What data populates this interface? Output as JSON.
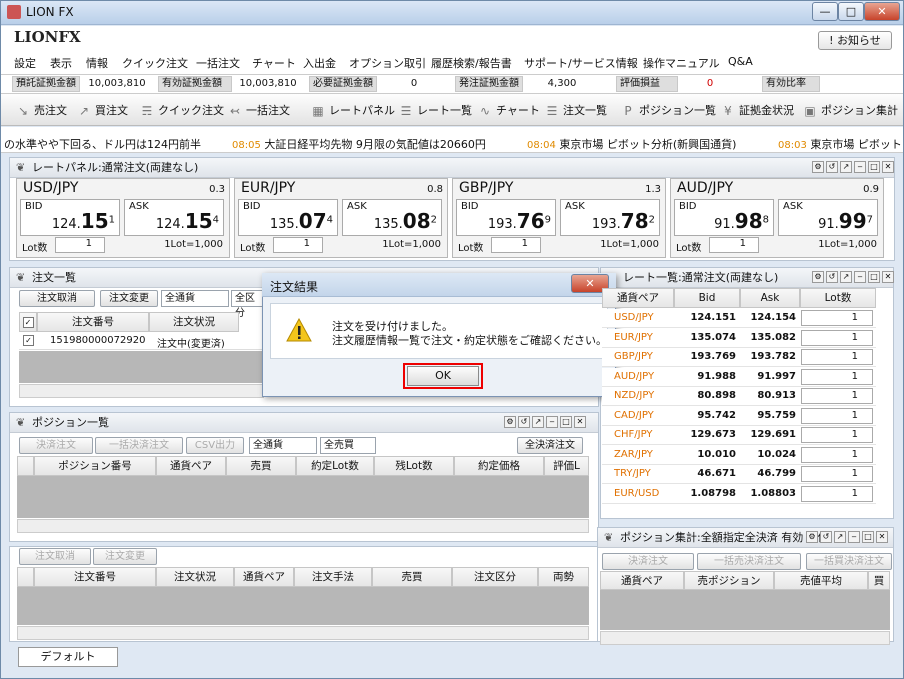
{
  "window": {
    "title": "LION FX",
    "minimize": "—",
    "maximize": "□",
    "close": "✕"
  },
  "brand": {
    "logo": "LIONFX",
    "notice_button": "! お知らせ"
  },
  "menu": [
    "設定",
    "表示",
    "情報",
    "クイック注文",
    "一括注文",
    "チャート",
    "入出金",
    "オプション取引",
    "履歴検索/報告書",
    "サポート/サービス情報",
    "操作マニュアル",
    "Q&A"
  ],
  "summary": [
    {
      "label": "預託証拠金額",
      "value": "10,003,810"
    },
    {
      "label": "有効証拠金額",
      "value": "10,003,810"
    },
    {
      "label": "必要証拠金額",
      "value": "0"
    },
    {
      "label": "発注証拠金額",
      "value": "4,300"
    },
    {
      "label": "評価損益",
      "value": "0",
      "value_color": "#d00000"
    },
    {
      "label": "有効比率",
      "value": ""
    }
  ],
  "toolbar": [
    "売注文",
    "買注文",
    "クイック注文",
    "一括注文",
    "レートパネル",
    "レート一覧",
    "チャート",
    "注文一覧",
    "ポジション一覧",
    "証拠金状況",
    "ポジション集計"
  ],
  "ticker": [
    {
      "time": "",
      "text": "の水準やや下回る、ドル円は124円前半"
    },
    {
      "time": "08:05",
      "text": "大証日経平均先物 9月限の気配値は20660円"
    },
    {
      "time": "08:04",
      "text": "東京市場 ピボット分析(新興国通貨)"
    },
    {
      "time": "08:03",
      "text": "東京市場 ピボット"
    }
  ],
  "rate_panel": {
    "title": "レートパネル:通常注文(両建なし)",
    "cards": [
      {
        "pair": "USD/JPY",
        "spread": "0.3",
        "bid": {
          "pre": "124.",
          "big": "15",
          "sup": "1"
        },
        "ask": {
          "pre": "124.",
          "big": "15",
          "sup": "4"
        },
        "lot": "1",
        "lot_unit": "1Lot=1,000"
      },
      {
        "pair": "EUR/JPY",
        "spread": "0.8",
        "bid": {
          "pre": "135.",
          "big": "07",
          "sup": "4"
        },
        "ask": {
          "pre": "135.",
          "big": "08",
          "sup": "2"
        },
        "lot": "1",
        "lot_unit": "1Lot=1,000"
      },
      {
        "pair": "GBP/JPY",
        "spread": "1.3",
        "bid": {
          "pre": "193.",
          "big": "76",
          "sup": "9"
        },
        "ask": {
          "pre": "193.",
          "big": "78",
          "sup": "2"
        },
        "lot": "1",
        "lot_unit": "1Lot=1,000"
      },
      {
        "pair": "AUD/JPY",
        "spread": "0.9",
        "bid": {
          "pre": "91.",
          "big": "98",
          "sup": "8"
        },
        "ask": {
          "pre": "91.",
          "big": "99",
          "sup": "7"
        },
        "lot": "1",
        "lot_unit": "1Lot=1,000"
      }
    ],
    "bid_label": "BID",
    "ask_label": "ASK",
    "lot_label": "Lot数"
  },
  "order_list": {
    "title": "注文一覧",
    "buttons": [
      "注文取消",
      "注文変更"
    ],
    "filters": [
      "全通貨",
      "全区分"
    ],
    "columns": [
      "注文番号",
      "注文状況"
    ],
    "rows": [
      {
        "id": "151980000072920",
        "status": "注文中(変更済)"
      }
    ]
  },
  "position_list": {
    "title": "ポジション一覧",
    "buttons": [
      "決済注文",
      "一括決済注文",
      "CSV出力"
    ],
    "filters": [
      "全通貨",
      "全売買"
    ],
    "settle_all": "全決済注文",
    "columns": [
      "ポジション番号",
      "通貨ペア",
      "売買",
      "約定Lot数",
      "残Lot数",
      "約定価格",
      "評価L"
    ]
  },
  "order_list2": {
    "buttons": [
      "注文取消",
      "注文変更"
    ],
    "columns": [
      "注文番号",
      "注文状況",
      "通貨ペア",
      "注文手法",
      "売買",
      "注文区分",
      "両勢"
    ]
  },
  "rate_list": {
    "title": "レート一覧:通常注文(両建なし)",
    "columns": [
      "通貨ペア",
      "Bid",
      "Ask",
      "Lot数"
    ],
    "rows": [
      {
        "pair": "USD/JPY",
        "bid": "124.151",
        "ask": "124.154",
        "lot": "1"
      },
      {
        "pair": "EUR/JPY",
        "bid": "135.074",
        "ask": "135.082",
        "lot": "1"
      },
      {
        "pair": "GBP/JPY",
        "bid": "193.769",
        "ask": "193.782",
        "lot": "1"
      },
      {
        "pair": "AUD/JPY",
        "bid": "91.988",
        "ask": "91.997",
        "lot": "1"
      },
      {
        "pair": "NZD/JPY",
        "bid": "80.898",
        "ask": "80.913",
        "lot": "1"
      },
      {
        "pair": "CAD/JPY",
        "bid": "95.742",
        "ask": "95.759",
        "lot": "1"
      },
      {
        "pair": "CHF/JPY",
        "bid": "129.673",
        "ask": "129.691",
        "lot": "1"
      },
      {
        "pair": "ZAR/JPY",
        "bid": "10.010",
        "ask": "10.024",
        "lot": "1"
      },
      {
        "pair": "TRY/JPY",
        "bid": "46.671",
        "ask": "46.799",
        "lot": "1"
      },
      {
        "pair": "EUR/USD",
        "bid": "1.08798",
        "ask": "1.08803",
        "lot": "1"
      }
    ]
  },
  "position_summary": {
    "title": "ポジション集計:全額指定全決済 有効 評価",
    "buttons": [
      "決済注文",
      "一括売決済注文",
      "一括買決済注文"
    ],
    "columns": [
      "通貨ペア",
      "売ポジション",
      "売値平均",
      "買"
    ]
  },
  "dialog": {
    "title": "注文結果",
    "line1": "注文を受け付けました。",
    "line2": "注文履歴情報一覧で注文・約定状態をご確認ください。",
    "ok": "OK",
    "close": "✕"
  },
  "tabs": [
    "デフォルト"
  ]
}
